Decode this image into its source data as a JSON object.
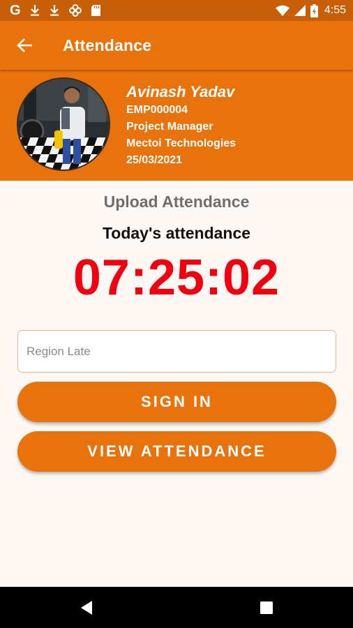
{
  "status_bar": {
    "time": "4:55",
    "left_icons": [
      "google-icon",
      "download-icon",
      "download-icon",
      "fan-icon",
      "sd-card-icon"
    ],
    "right_icons": [
      "wifi-icon",
      "cellular-signal-icon",
      "battery-icon"
    ],
    "google_letter": "G"
  },
  "app_bar": {
    "title": "Attendance",
    "back_icon": "arrow-left-icon"
  },
  "profile": {
    "name": "Avinash Yadav",
    "employee_id": "EMP000004",
    "role": "Project Manager",
    "company": "Mectoi Technologies",
    "date": "25/03/2021"
  },
  "main": {
    "upload_title": "Upload Attendance",
    "today_title": "Today's attendance",
    "clock": "07:25:02",
    "region_input": {
      "value": "",
      "placeholder": "Region Late"
    },
    "sign_in_label": "SIGN IN",
    "view_attendance_label": "VIEW ATTENDANCE"
  },
  "nav_bar": {
    "icons": [
      "back-triangle-icon",
      "home-circle-icon",
      "recents-square-icon"
    ]
  },
  "colors": {
    "primary": "#e8720c",
    "status_bar": "#c85f08",
    "clock": "#f2000f",
    "background": "#fdf8f4"
  }
}
